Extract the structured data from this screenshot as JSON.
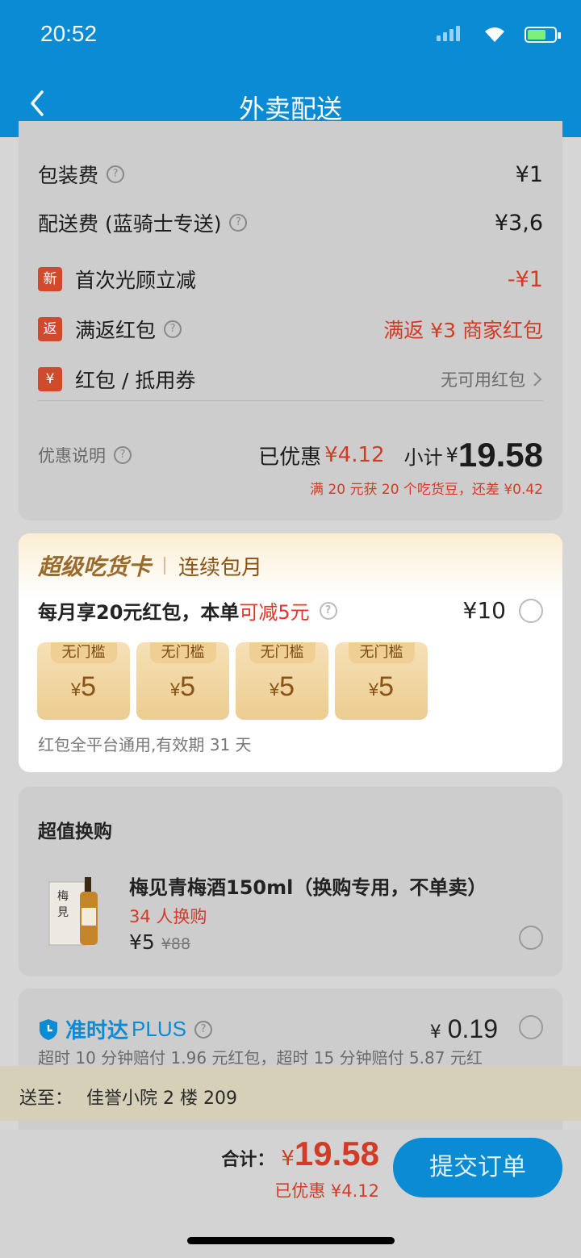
{
  "status_bar": {
    "time": "20:52"
  },
  "nav": {
    "title": "外卖配送"
  },
  "fees": {
    "packaging": {
      "label": "包装费",
      "value": "¥1"
    },
    "delivery": {
      "label": "配送费 (蓝骑士专送)",
      "value": "¥3,6"
    },
    "first_visit": {
      "tag": "新",
      "label": "首次光顾立减",
      "value": "-¥1"
    },
    "cashback": {
      "tag": "返",
      "label": "满返红包",
      "value": "满返 ¥3 商家红包"
    },
    "coupon": {
      "tag": "¥",
      "label": "红包 / 抵用券",
      "value": "无可用红包"
    }
  },
  "summary": {
    "discount_desc": "优惠说明",
    "saved_label": "已优惠",
    "saved_value": "¥4.12",
    "subtotal_label": "小计",
    "subtotal_currency": "¥",
    "subtotal_value": "19.58",
    "note": "满 20 元获 20 个吃货豆，还差 ¥0.42"
  },
  "vip_card": {
    "brand": "超级吃货卡",
    "plan": "连续包月",
    "offer_prefix": "每月享20元红包，本单",
    "offer_highlight": "可减5元",
    "price": "¥10",
    "coupons": [
      {
        "label": "无门槛",
        "currency": "¥",
        "amount": "5"
      },
      {
        "label": "无门槛",
        "currency": "¥",
        "amount": "5"
      },
      {
        "label": "无门槛",
        "currency": "¥",
        "amount": "5"
      },
      {
        "label": "无门槛",
        "currency": "¥",
        "amount": "5"
      }
    ],
    "footnote": "红包全平台通用,有效期 31 天"
  },
  "exchange": {
    "title": "超值换购",
    "item": {
      "name": "梅见青梅酒150ml（换购专用，不单卖）",
      "count": "34 人换购",
      "price": "¥5",
      "original_price": "¥88"
    }
  },
  "ontime": {
    "brand": "准时达",
    "plus": "PLUS",
    "price_currency": "¥",
    "price": "0.19",
    "desc": "超时 10 分钟赔付 1.96 元红包，超时 15 分钟赔付 5.87 元红"
  },
  "address": {
    "label": "送至：",
    "value": "佳誉小院 2 楼 209"
  },
  "footer": {
    "total_label": "合计：",
    "total_currency": "¥",
    "total_value": "19.58",
    "saved": "已优惠 ¥4.12",
    "submit": "提交订单"
  },
  "colors": {
    "brand_blue": "#0a8bd4",
    "price_red": "#d23b25",
    "gold": "#8a5416"
  }
}
